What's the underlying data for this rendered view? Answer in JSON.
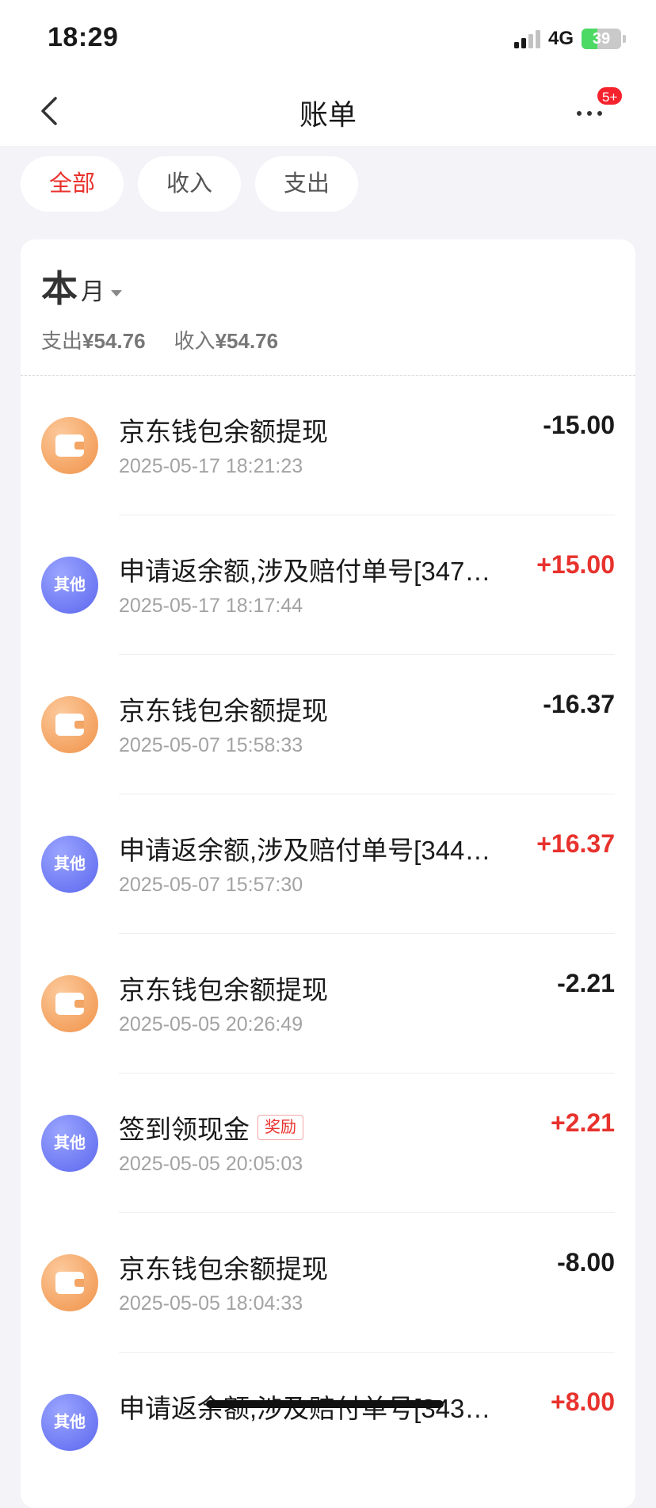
{
  "status_bar": {
    "time": "18:29",
    "network": "4G",
    "battery": "39",
    "battery_level": 0.39
  },
  "nav": {
    "title": "账单",
    "badge": "5+"
  },
  "filters": [
    {
      "label": "全部",
      "active": true
    },
    {
      "label": "收入",
      "active": false
    },
    {
      "label": "支出",
      "active": false
    }
  ],
  "period": {
    "big": "本",
    "small": "月",
    "expense_label": "支出",
    "expense_value": "¥54.76",
    "income_label": "收入",
    "income_value": "¥54.76"
  },
  "transactions": [
    {
      "icon": "wallet-icon",
      "icon_text": "",
      "title": "京东钱包余额提现",
      "tag": "",
      "time": "2025-05-17 18:21:23",
      "amount": "-15.00",
      "sign": "neg"
    },
    {
      "icon": "other-icon",
      "icon_text": "其他",
      "title": "申请返余额,涉及赔付单号[347…",
      "tag": "",
      "time": "2025-05-17 18:17:44",
      "amount": "+15.00",
      "sign": "pos"
    },
    {
      "icon": "wallet-icon",
      "icon_text": "",
      "title": "京东钱包余额提现",
      "tag": "",
      "time": "2025-05-07 15:58:33",
      "amount": "-16.37",
      "sign": "neg"
    },
    {
      "icon": "other-icon",
      "icon_text": "其他",
      "title": "申请返余额,涉及赔付单号[344…",
      "tag": "",
      "time": "2025-05-07 15:57:30",
      "amount": "+16.37",
      "sign": "pos"
    },
    {
      "icon": "wallet-icon",
      "icon_text": "",
      "title": "京东钱包余额提现",
      "tag": "",
      "time": "2025-05-05 20:26:49",
      "amount": "-2.21",
      "sign": "neg"
    },
    {
      "icon": "other-icon",
      "icon_text": "其他",
      "title": "签到领现金",
      "tag": "奖励",
      "time": "2025-05-05 20:05:03",
      "amount": "+2.21",
      "sign": "pos"
    },
    {
      "icon": "wallet-icon",
      "icon_text": "",
      "title": "京东钱包余额提现",
      "tag": "",
      "time": "2025-05-05 18:04:33",
      "amount": "-8.00",
      "sign": "neg"
    },
    {
      "icon": "other-icon",
      "icon_text": "其他",
      "title": "申请返余额,涉及赔付单号[343…",
      "tag": "",
      "time": "",
      "amount": "+8.00",
      "sign": "pos"
    }
  ],
  "colors": {
    "accent": "#e8322d",
    "background": "#f3f3f8",
    "wallet_icon": "#f09248",
    "other_icon": "#5b66ee"
  }
}
